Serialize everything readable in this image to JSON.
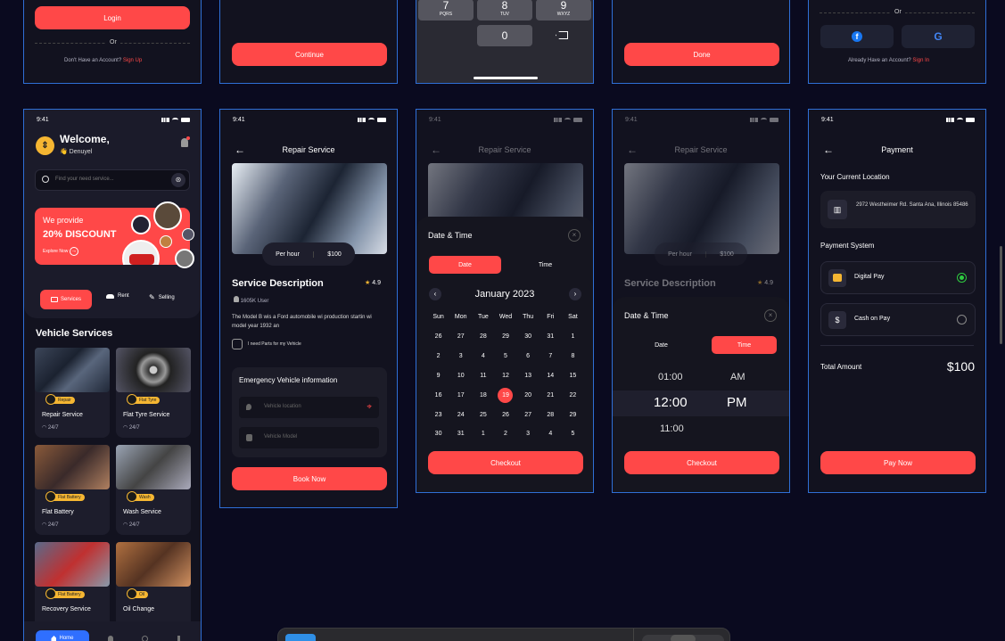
{
  "top_row": {
    "login": {
      "login_label": "Login",
      "or_label": "Or",
      "no_account": "Don't Have an Account?",
      "sign_up": "Sign Up"
    },
    "continue_label": "Continue",
    "keypad": {
      "keys": [
        {
          "digit": "7",
          "letters": "PQRS"
        },
        {
          "digit": "8",
          "letters": "TUV"
        },
        {
          "digit": "9",
          "letters": "WXYZ"
        }
      ],
      "zero": "0"
    },
    "done_label": "Done",
    "signup": {
      "or_label": "Or",
      "have_account": "Already Have an Account?",
      "sign_in": "Sign In"
    }
  },
  "status_time": "9:41",
  "home": {
    "welcome": "Welcome,",
    "user": "👋 Denuyel",
    "search_placeholder": "Find your need service...",
    "promo_line1": "We provide",
    "promo_line2": "20% DISCOUNT",
    "promo_cta": "Explore Now",
    "tabs": [
      "Services",
      "Rent",
      "Selling"
    ],
    "section_title": "Vehicle Services",
    "services": [
      {
        "badge": "Repair",
        "name": "Repair Service",
        "hours": "24/7"
      },
      {
        "badge": "Flat Tyre",
        "name": "Flat Tyre Service",
        "hours": "24/7"
      },
      {
        "badge": "Flat Battery",
        "name": "Flat Battery",
        "hours": "24/7"
      },
      {
        "badge": "Wash",
        "name": "Wash Service",
        "hours": "24/7"
      },
      {
        "badge": "Flat Battery",
        "name": "Recovery Service",
        "hours": "24/7"
      },
      {
        "badge": "Oil",
        "name": "Oil Change",
        "hours": "24/7"
      }
    ],
    "nav_home": "Home"
  },
  "repair": {
    "title": "Repair Service",
    "per_hour": "Per hour",
    "price": "$100",
    "desc_title": "Service Description",
    "rating": "4.9",
    "users": "1605K User",
    "desc": "The Model B wis a Ford automobile wi production startin wi model year 1932 an",
    "parts": "I need Parts for my Vehicle",
    "emergency_title": "Emergency Vehicle information",
    "location_placeholder": "Vehicle location",
    "model_placeholder": "Vehicle Model",
    "book_now": "Book Now"
  },
  "datetime": {
    "title": "Date & Time",
    "date_tab": "Date",
    "time_tab": "Time",
    "month": "January 2023",
    "weekdays": [
      "Sun",
      "Mon",
      "Tue",
      "Wed",
      "Thu",
      "Fri",
      "Sat"
    ],
    "days": [
      "26",
      "27",
      "28",
      "29",
      "30",
      "31",
      "1",
      "2",
      "3",
      "4",
      "5",
      "6",
      "7",
      "8",
      "9",
      "10",
      "11",
      "12",
      "13",
      "14",
      "15",
      "16",
      "17",
      "18",
      "19",
      "20",
      "21",
      "22",
      "23",
      "24",
      "25",
      "26",
      "27",
      "28",
      "29",
      "30",
      "31",
      "1",
      "2",
      "3",
      "4",
      "5"
    ],
    "selected": "19",
    "checkout": "Checkout",
    "times": [
      "01:00",
      "12:00",
      "11:00"
    ],
    "ampm": [
      "AM",
      "PM"
    ]
  },
  "payment": {
    "title": "Payment",
    "location_label": "Your Current Location",
    "address": "2972 Westheimer Rd. Santa Ana, Illinois 85486",
    "system_label": "Payment System",
    "methods": [
      "Digital Pay",
      "Cash on Pay"
    ],
    "total_label": "Total Amount",
    "total": "$100",
    "pay_now": "Pay Now"
  },
  "colors": {
    "accent": "#ff4848",
    "frame": "#2f6fd6",
    "bg": "#0a0a1f",
    "gold": "#f5b632",
    "green": "#2ecc40"
  }
}
